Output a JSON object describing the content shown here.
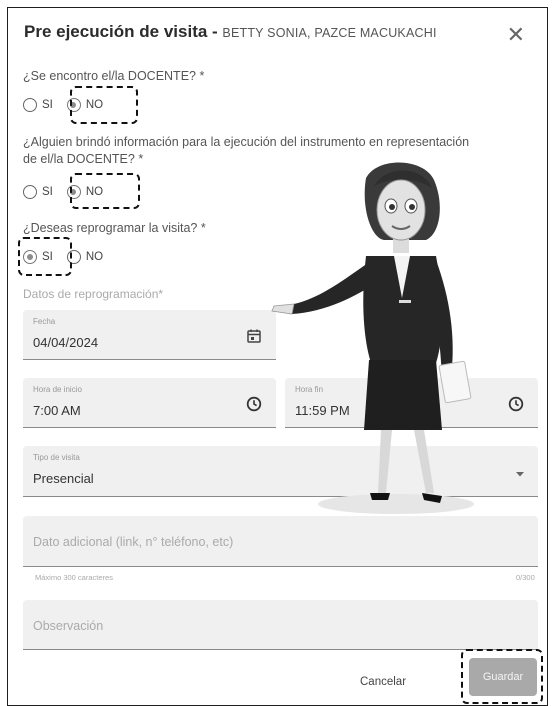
{
  "dialog": {
    "title": "Pre ejecución de visita - ",
    "subtitle": "BETTY SONIA, PAZCE MACUKACHI",
    "close_icon": "close-icon"
  },
  "questions": [
    {
      "label": "¿Se encontro el/la DOCENTE? *",
      "options": [
        {
          "label": "SI",
          "selected": false
        },
        {
          "label": "NO",
          "selected": true
        }
      ]
    },
    {
      "label_line1": "¿Alguien brindó información para la ejecución del instrumento en representación",
      "label_line2": "de el/la DOCENTE? *",
      "options": [
        {
          "label": "SI",
          "selected": false
        },
        {
          "label": "NO",
          "selected": true
        }
      ]
    },
    {
      "label": "¿Deseas reprogramar la visita? *",
      "options": [
        {
          "label": "SI",
          "selected": true
        },
        {
          "label": "NO",
          "selected": false
        }
      ]
    }
  ],
  "reprogramming": {
    "section_label": "Datos de reprogramación*",
    "date": {
      "label": "Fecha",
      "value": "04/04/2024",
      "icon": "calendar-icon"
    },
    "start_time": {
      "label": "Hora de inicio",
      "value": "7:00 AM",
      "icon": "clock-icon"
    },
    "end_time": {
      "label": "Hora fin",
      "value": "11:59 PM",
      "icon": "clock-icon"
    },
    "visit_type": {
      "label": "Tipo de visita",
      "value": "Presencial",
      "icon": "dropdown-arrow-icon"
    },
    "additional": {
      "placeholder": "Dato adicional (link, n° teléfono, etc)",
      "hint": "Máximo 300 caracteres",
      "counter": "0/300"
    },
    "observation": {
      "placeholder": "Observación"
    }
  },
  "actions": {
    "cancel_label": "Cancelar",
    "save_label": "Guardar"
  },
  "colors": {
    "field_bg": "#f0f0f0",
    "save_button_bg": "#a9a9a9",
    "highlight_border": "#111111"
  }
}
